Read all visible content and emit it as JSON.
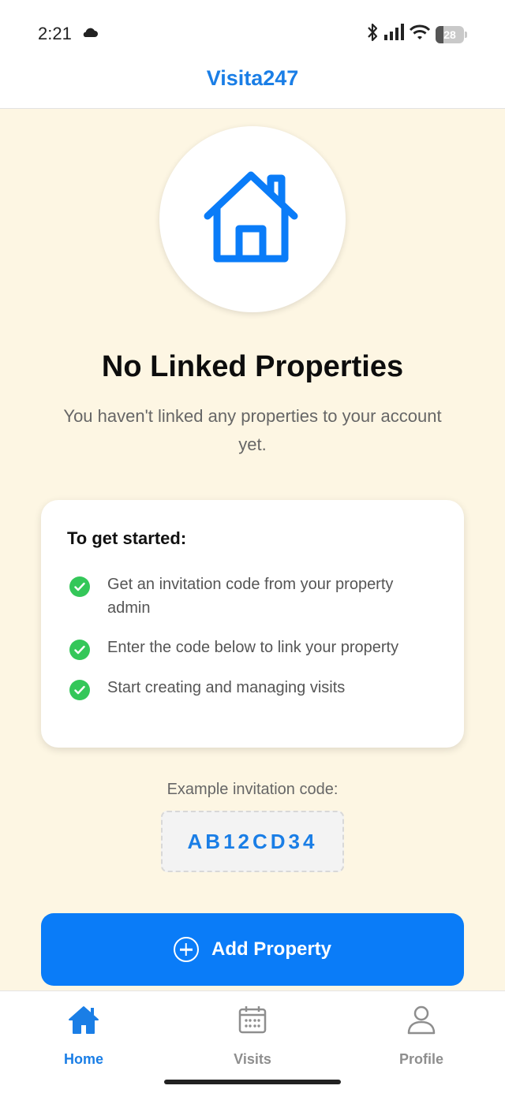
{
  "status_bar": {
    "time": "2:21",
    "battery_level": "28"
  },
  "header": {
    "title": "Visita247"
  },
  "empty_state": {
    "icon": "house-icon",
    "title": "No Linked Properties",
    "subtitle": "You haven't linked any properties to your account yet."
  },
  "instructions": {
    "title": "To get started:",
    "steps": [
      {
        "text": "Get an invitation code from your property admin"
      },
      {
        "text": "Enter the code below to link your property"
      },
      {
        "text": "Start creating and managing visits"
      }
    ]
  },
  "example_code": {
    "label": "Example invitation code:",
    "code": "AB12CD34"
  },
  "add_property": {
    "label": "Add Property"
  },
  "bottom_nav": {
    "items": [
      {
        "label": "Home",
        "icon": "home-icon",
        "active": true
      },
      {
        "label": "Visits",
        "icon": "calendar-icon",
        "active": false
      },
      {
        "label": "Profile",
        "icon": "user-icon",
        "active": false
      }
    ]
  },
  "colors": {
    "accent": "#1a7ee6",
    "button": "#0a7cf8",
    "background": "#fdf6e3",
    "success": "#34c759"
  }
}
